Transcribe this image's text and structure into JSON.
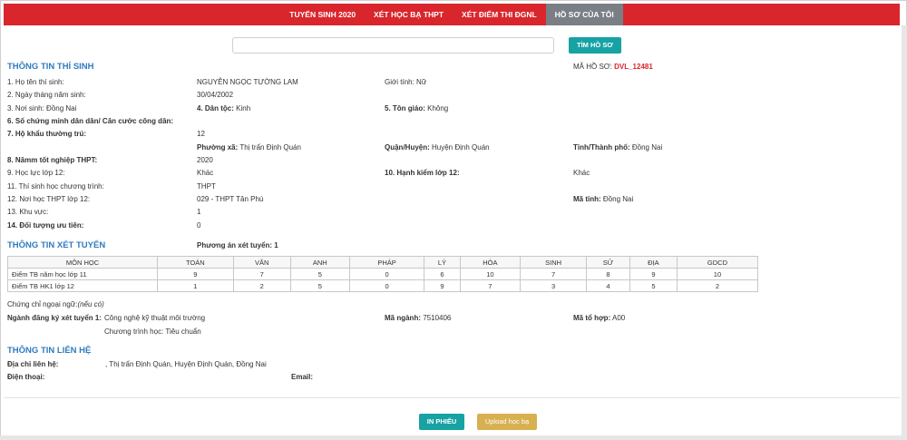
{
  "nav": {
    "items": [
      "TUYỂN SINH 2020",
      "XÉT HỌC BẠ THPT",
      "XÉT ĐIỂM THI ĐGNL",
      "HỒ SƠ CỦA TÔI"
    ]
  },
  "search": {
    "button": "TÌM HỒ SƠ",
    "placeholder": ""
  },
  "profile": {
    "section_title": "THÔNG TIN THÍ SINH",
    "code_label": "MÃ HỒ SƠ:",
    "code_value": "DVL_12481",
    "name_label": "1. Họ tên thí sinh:",
    "name_value": "NGUYỄN NGỌC TƯỜNG LAM",
    "gender": "Giới tính: Nữ",
    "dob_label": "2. Ngày tháng năm sinh:",
    "dob_value": "30/04/2002",
    "birthplace": "3. Nơi sinh: Đồng Nai",
    "ethnicity_label": "4. Dân tộc:",
    "ethnicity_value": " Kinh",
    "religion_label": "5. Tôn giáo:",
    "religion_value": " Không",
    "id_label": "6. Số chứng minh dân dân/ Căn cước công dân:",
    "residence_label": "7. Hộ khẩu thường trú:",
    "residence_value": "12",
    "ward_label": "Phường xã:",
    "ward_value": " Thị trấn Định Quán",
    "district_label": "Quận/Huyện:",
    "district_value": " Huyện Định Quán",
    "province_label": "Tỉnh/Thành phố:",
    "province_value": " Đồng Nai",
    "grad_year_label": "8. Nămm tốt nghiệp THPT:",
    "grad_year_value": "2020",
    "academic_label": "9. Học lực lớp 12:",
    "academic_value": "Khác",
    "conduct_label": "10. Hạnh kiểm lớp 12:",
    "conduct_value": "Khác",
    "program_label": "11. Thí sinh học chương trình:",
    "program_value": "THPT",
    "school_label": "12. Nơi học THPT lớp 12:",
    "school_value": "029 - THPT Tân Phú",
    "province_code_label": "Mã tỉnh:",
    "province_code_value": " Đồng Nai",
    "area_label": "13. Khu vực:",
    "area_value": "1",
    "priority_label": "14. Đối tượng ưu tiên:",
    "priority_value": "0"
  },
  "admission": {
    "section_title": "THÔNG TIN XÉT TUYỂN",
    "method": "Phương án xét tuyển: 1",
    "table": {
      "headers": [
        "MÔN HỌC",
        "TOÁN",
        "VĂN",
        "ANH",
        "PHÁP",
        "LÝ",
        "HÓA",
        "SINH",
        "SỬ",
        "ĐỊA",
        "GDCD"
      ],
      "rows": [
        {
          "label": "Điểm TB năm học lớp 11",
          "values": [
            "9",
            "7",
            "5",
            "0",
            "6",
            "10",
            "7",
            "8",
            "9",
            "10"
          ]
        },
        {
          "label": "Điểm TB HK1 lớp 12",
          "values": [
            "1",
            "2",
            "5",
            "0",
            "9",
            "7",
            "3",
            "4",
            "5",
            "2"
          ]
        }
      ]
    },
    "cert_label": "Chứng chỉ ngoại ngữ:",
    "cert_note": "(nếu có)",
    "major_label": "Ngành đăng ký xét tuyển 1:",
    "major_value": "Công nghệ kỹ thuật môi trường",
    "program": "Chương trình học: Tiêu chuẩn",
    "major_code_label": "Mã ngành:",
    "major_code_value": " 7510406",
    "combo_label": "Mã tổ hợp:",
    "combo_value": " A00"
  },
  "contact": {
    "section_title": "THÔNG TIN LIÊN HỆ",
    "address_label": "Địa chỉ liên hệ:",
    "address_value": ", Thị trấn Định Quán, Huyện Định Quán, Đồng Nai",
    "phone_label": "Điện thoại:",
    "email_label": "Email:"
  },
  "footer": {
    "print_button": "IN PHIẾU",
    "upload_button": "Upload học bạ"
  }
}
